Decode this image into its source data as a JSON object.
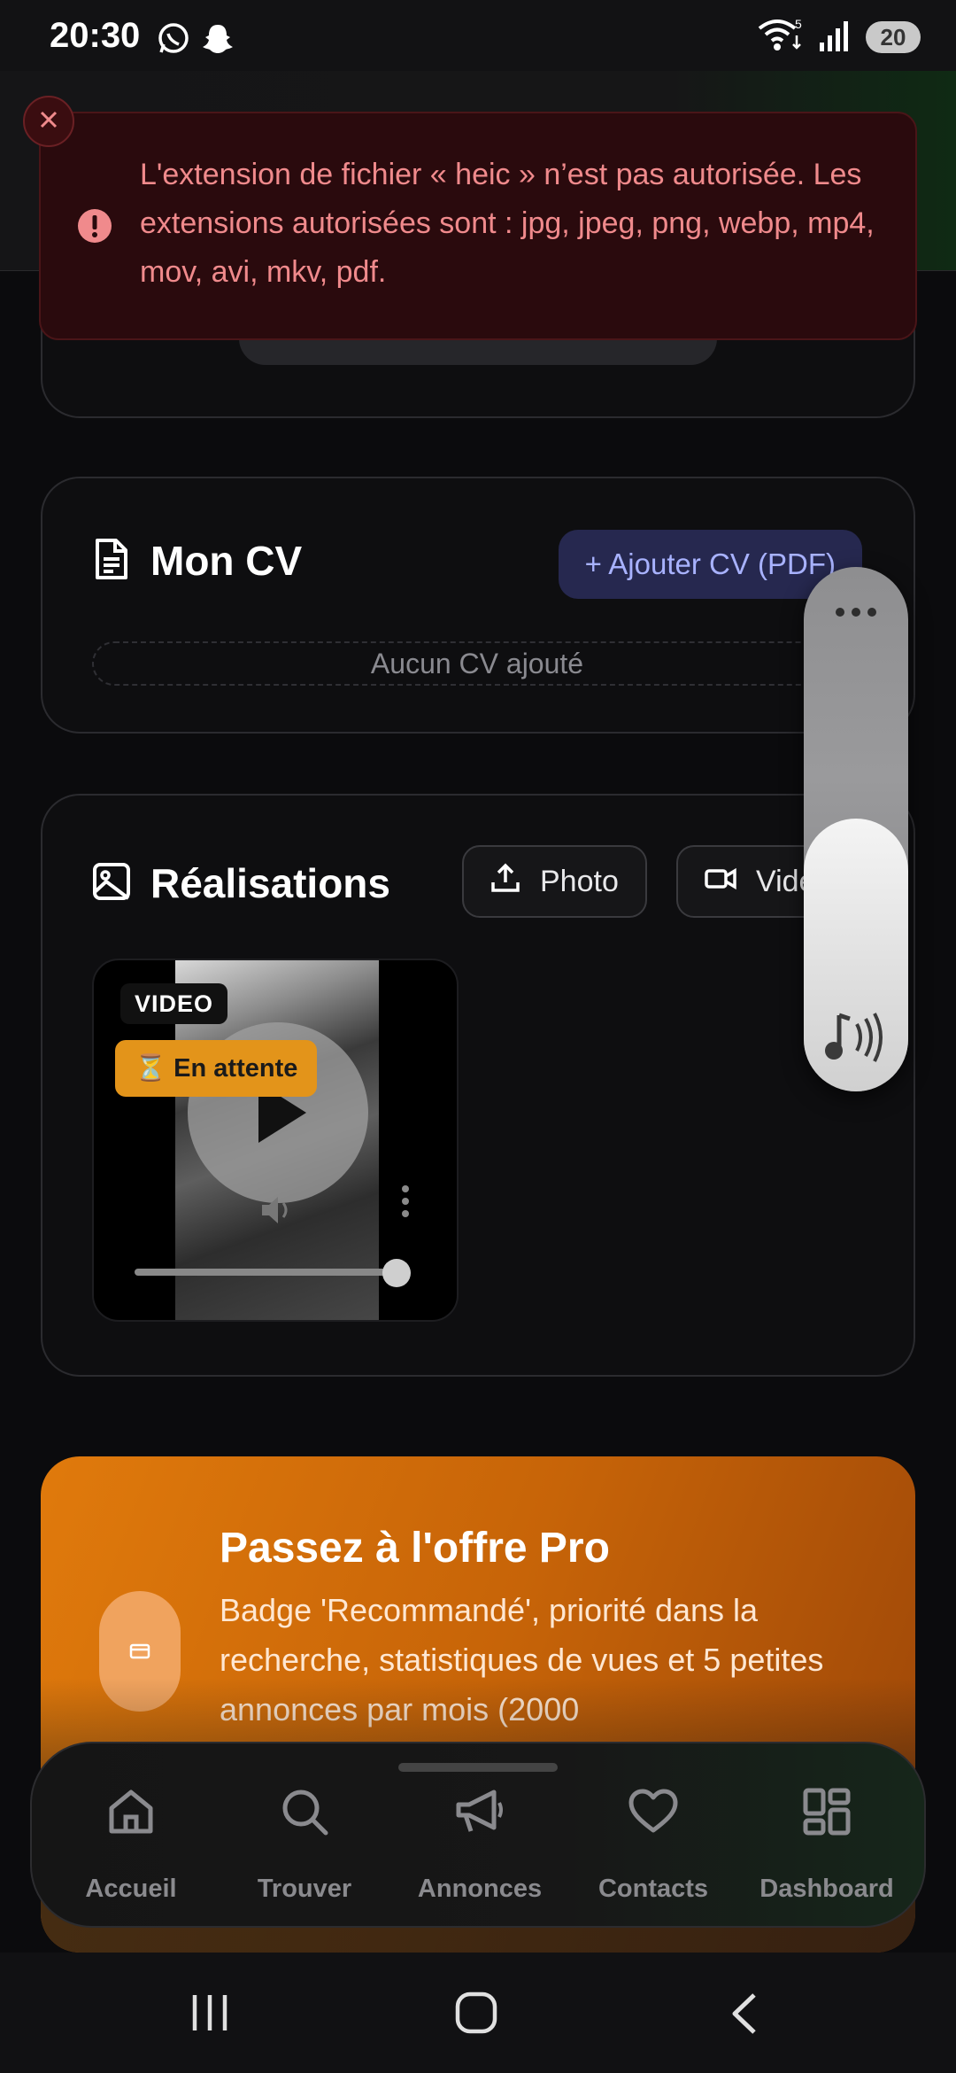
{
  "status_bar": {
    "time": "20:30",
    "battery": "20",
    "signal_label": "5"
  },
  "toast": {
    "message": "L'extension de fichier « heic » n’est pas autorisée. Les extensions autorisées sont : jpg, jpeg, png, webp, mp4, mov, avi, mkv, pdf.",
    "color": "#f08a8c"
  },
  "cv_card": {
    "title": "Mon CV",
    "add_button": "+ Ajouter CV (PDF)",
    "empty_text": "Aucun CV ajouté"
  },
  "realisations_card": {
    "title": "Réalisations",
    "photo_button": "Photo",
    "video_button": "Vidéo",
    "tile": {
      "type_chip": "VIDEO",
      "status_badge": "⏳ En attente"
    }
  },
  "promo": {
    "title": "Passez à l'offre Pro",
    "description": "Badge 'Recommandé', priorité dans la recherche, statistiques de vues et 5 petites annonces par mois (2000"
  },
  "bottom_nav": {
    "items": [
      {
        "label": "Accueil",
        "icon": "home-icon"
      },
      {
        "label": "Trouver",
        "icon": "search-icon"
      },
      {
        "label": "Annonces",
        "icon": "megaphone-icon"
      },
      {
        "label": "Contacts",
        "icon": "heart-icon"
      },
      {
        "label": "Dashboard",
        "icon": "grid-icon"
      }
    ]
  },
  "volume": {
    "level": 0.52
  }
}
